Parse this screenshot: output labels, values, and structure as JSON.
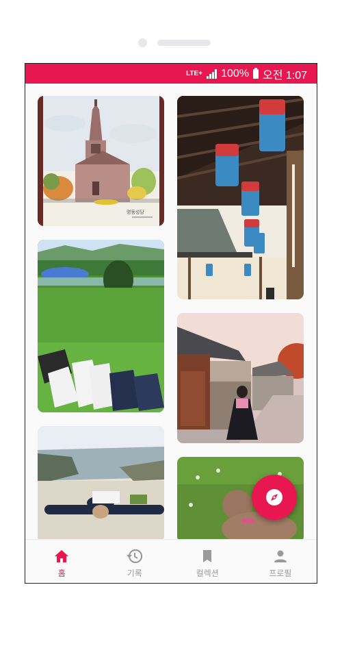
{
  "status_bar": {
    "network": "LTE+",
    "battery": "100%",
    "time": "오전 1:07",
    "color": "#e8174f"
  },
  "feed": {
    "items": [
      {
        "image": "cathedral-watercolor-sketch",
        "handwriting": "명동성당"
      },
      {
        "image": "hanok-eaves-lanterns"
      },
      {
        "image": "grass-field-sneakers"
      },
      {
        "image": "hanok-alley-hanbok"
      },
      {
        "image": "mountain-summit-person"
      },
      {
        "image": "poodle-on-grass"
      }
    ]
  },
  "fab": {
    "icon": "compass-icon",
    "color": "#e8174f"
  },
  "bottom_nav": {
    "items": [
      {
        "label": "홈",
        "icon": "home-icon",
        "active": true
      },
      {
        "label": "기록",
        "icon": "history-icon",
        "active": false
      },
      {
        "label": "컬렉션",
        "icon": "bookmark-icon",
        "active": false
      },
      {
        "label": "프로필",
        "icon": "person-icon",
        "active": false
      }
    ]
  }
}
